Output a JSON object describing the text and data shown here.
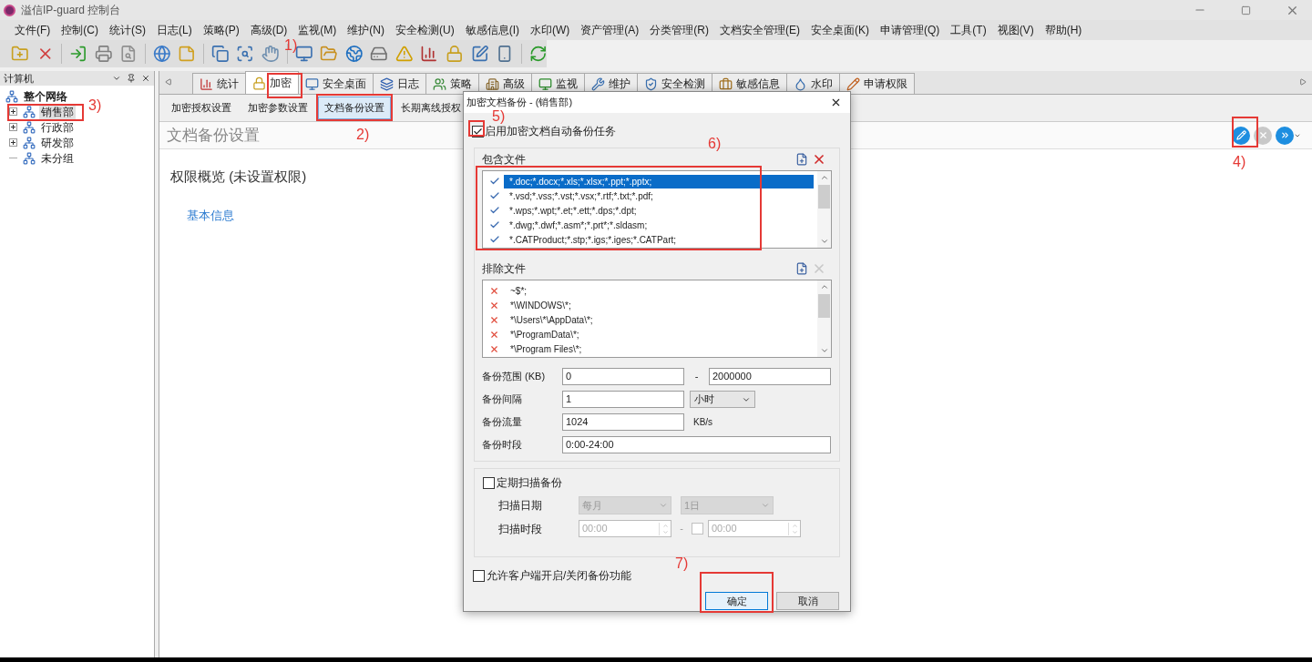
{
  "window": {
    "title": "溢信IP-guard 控制台"
  },
  "menu": [
    "文件(F)",
    "控制(C)",
    "统计(S)",
    "日志(L)",
    "策略(P)",
    "高级(D)",
    "监视(M)",
    "维护(N)",
    "安全检测(U)",
    "敏感信息(I)",
    "水印(W)",
    "资产管理(A)",
    "分类管理(R)",
    "文档安全管理(E)",
    "安全桌面(K)",
    "申请管理(Q)",
    "工具(T)",
    "视图(V)",
    "帮助(H)"
  ],
  "left_panel": {
    "title": "计算机",
    "tree": [
      {
        "label": "整个网络",
        "selected": false,
        "children": [
          {
            "label": "销售部",
            "expanded": false,
            "selected": true
          },
          {
            "label": "行政部",
            "expanded": false,
            "selected": false
          },
          {
            "label": "研发部",
            "expanded": false,
            "selected": false
          },
          {
            "label": "未分组",
            "selected": false
          }
        ]
      }
    ]
  },
  "tabs": [
    {
      "label": "统计",
      "selected": false
    },
    {
      "label": "加密",
      "selected": true
    },
    {
      "label": "安全桌面",
      "selected": false
    },
    {
      "label": "日志",
      "selected": false
    },
    {
      "label": "策略",
      "selected": false
    },
    {
      "label": "高级",
      "selected": false
    },
    {
      "label": "监视",
      "selected": false
    },
    {
      "label": "维护",
      "selected": false
    },
    {
      "label": "安全检测",
      "selected": false
    },
    {
      "label": "敏感信息",
      "selected": false
    },
    {
      "label": "水印",
      "selected": false
    },
    {
      "label": "申请权限",
      "selected": false
    }
  ],
  "subtabs": [
    {
      "label": "加密授权设置",
      "selected": false
    },
    {
      "label": "加密参数设置",
      "selected": false
    },
    {
      "label": "文档备份设置",
      "selected": true
    },
    {
      "label": "长期离线授权",
      "selected": false
    }
  ],
  "page": {
    "title": "文档备份设置",
    "summary": "权限概览 (未设置权限)",
    "link": "基本信息",
    "actions": [
      {
        "kind": "edit",
        "disabled": false
      },
      {
        "kind": "delete",
        "disabled": true
      },
      {
        "kind": "more",
        "disabled": false
      }
    ]
  },
  "dialog": {
    "title": "加密文档备份 - (销售部)",
    "enable": {
      "label": "启用加密文档自动备份任务",
      "checked": true
    },
    "include": {
      "label": "包含文件",
      "delete_disabled": false,
      "rows": [
        {
          "text": "*.doc;*.docx;*.xls;*.xlsx;*.ppt;*.pptx;",
          "checked": true,
          "selected": true
        },
        {
          "text": "*.vsd;*.vss;*.vst;*.vsx;*.rtf;*.txt;*.pdf;",
          "checked": true,
          "selected": false
        },
        {
          "text": "*.wps;*.wpt;*.et;*.ett;*.dps;*.dpt;",
          "checked": true,
          "selected": false
        },
        {
          "text": "*.dwg;*.dwf;*.asm*;*.prt*;*.sldasm;",
          "checked": true,
          "selected": false
        },
        {
          "text": "*.CATProduct;*.stp;*.igs;*.iges;*.CATPart;",
          "checked": true,
          "selected": false
        }
      ]
    },
    "exclude": {
      "label": "排除文件",
      "delete_disabled": true,
      "rows": [
        {
          "text": "~$*;"
        },
        {
          "text": "*\\WINDOWS\\*;"
        },
        {
          "text": "*\\Users\\*\\AppData\\*;"
        },
        {
          "text": "*\\ProgramData\\*;"
        },
        {
          "text": "*\\Program Files\\*;"
        }
      ]
    },
    "fields": [
      {
        "kind": "range",
        "label": "备份范围 (KB)",
        "value": "0",
        "separator": "-",
        "value2": "2000000"
      },
      {
        "kind": "select",
        "label": "备份间隔",
        "value": "1",
        "option": "小时"
      },
      {
        "kind": "unit",
        "label": "备份流量",
        "value": "1024",
        "unit": "KB/s"
      },
      {
        "kind": "text",
        "label": "备份时段",
        "value": "0:00-24:00"
      }
    ],
    "scan": {
      "label": "定期扫描备份",
      "checked": false,
      "disabled": true,
      "date_label": "扫描日期",
      "period": "每月",
      "day": "1日",
      "time_label": "扫描时段",
      "from": "00:00",
      "separator": "-",
      "to_checked": false,
      "to": "00:00"
    },
    "allow": {
      "label": "允许客户端开启/关闭备份功能",
      "checked": false
    },
    "buttons": [
      {
        "label": "确定",
        "default": true
      },
      {
        "label": "取消",
        "default": false
      }
    ]
  },
  "annotations": [
    {
      "label": "1)"
    },
    {
      "label": "2)"
    },
    {
      "label": "3)"
    },
    {
      "label": "4)"
    },
    {
      "label": "5)"
    },
    {
      "label": "6)"
    },
    {
      "label": "7)"
    }
  ]
}
